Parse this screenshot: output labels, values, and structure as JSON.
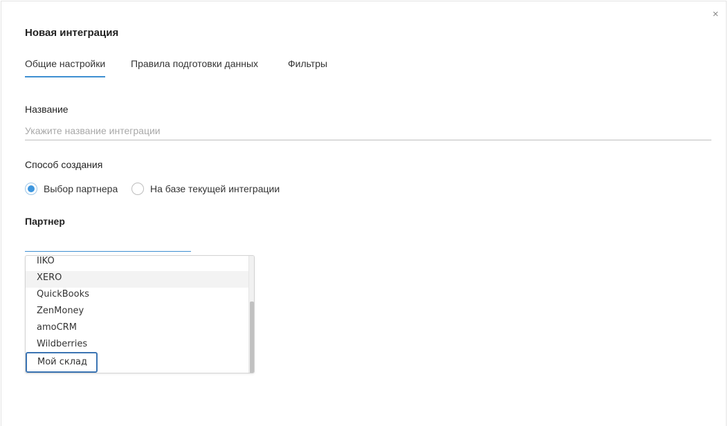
{
  "modal": {
    "title": "Новая интеграция",
    "close_glyph": "×"
  },
  "tabs": [
    {
      "label": "Общие настройки",
      "active": true
    },
    {
      "label": "Правила подготовки данных",
      "active": false
    },
    {
      "label": "Фильтры",
      "active": false
    }
  ],
  "name_field": {
    "label": "Название",
    "placeholder": "Укажите название интеграции",
    "value": ""
  },
  "creation_method": {
    "label": "Способ создания",
    "options": [
      {
        "label": "Выбор партнера",
        "selected": true
      },
      {
        "label": "На базе текущей интеграции",
        "selected": false
      }
    ]
  },
  "partner": {
    "label": "Партнер",
    "value": "",
    "options": [
      {
        "label": "IIKO"
      },
      {
        "label": "XERO",
        "hovered": true
      },
      {
        "label": "QuickBooks"
      },
      {
        "label": "ZenMoney"
      },
      {
        "label": "amoCRM"
      },
      {
        "label": "Wildberries"
      },
      {
        "label": "Мой склад",
        "focused": true
      }
    ]
  },
  "colors": {
    "accent": "#3d8fd1",
    "radio_dot": "#3d96de",
    "focus_border": "#3b74b3"
  }
}
